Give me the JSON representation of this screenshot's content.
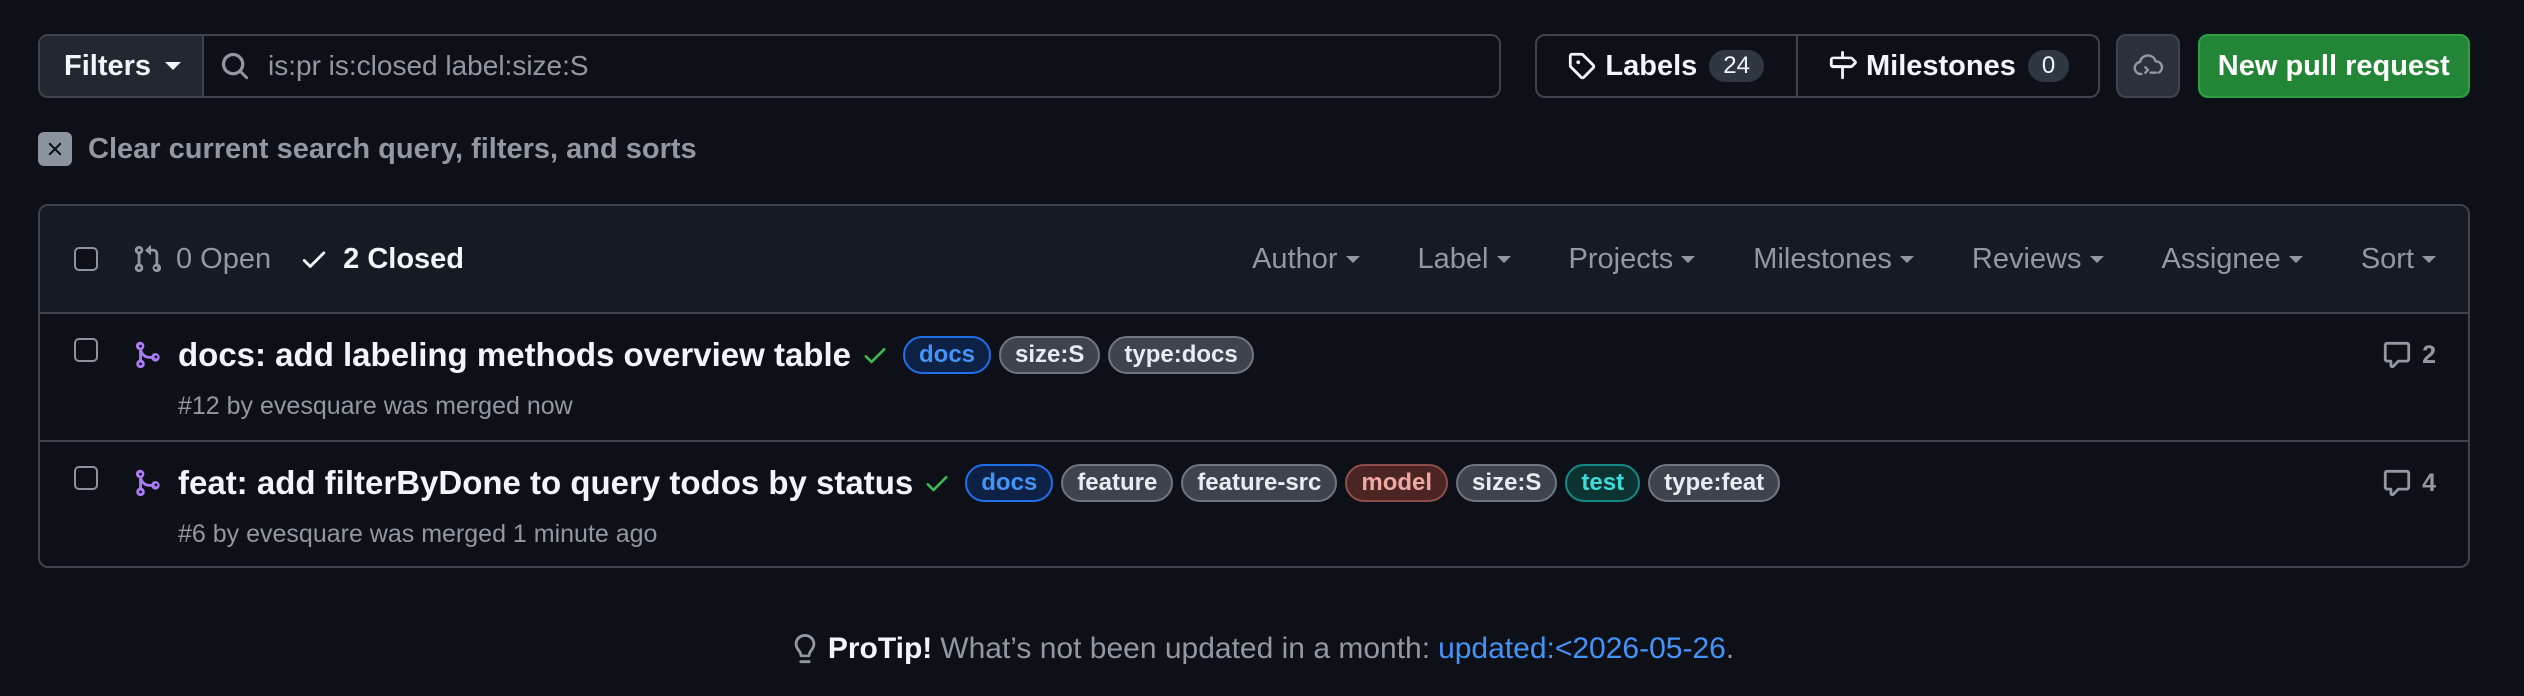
{
  "toolbar": {
    "filters_label": "Filters",
    "search_value": "is:pr is:closed label:size:S",
    "labels_label": "Labels",
    "labels_count": "24",
    "milestones_label": "Milestones",
    "milestones_count": "0",
    "new_pr_label": "New pull request"
  },
  "clear": {
    "label": "Clear current search query, filters, and sorts"
  },
  "list_header": {
    "open_label": "0 Open",
    "closed_label": "2 Closed",
    "filters": [
      "Author",
      "Label",
      "Projects",
      "Milestones",
      "Reviews",
      "Assignee",
      "Sort"
    ]
  },
  "pull_requests": [
    {
      "title": "docs: add labeling methods overview table",
      "meta": "#12 by evesquare was merged now",
      "comments": "2",
      "labels": [
        "docs",
        "size:S",
        "type:docs"
      ]
    },
    {
      "title": "feat: add filterByDone to query todos by status",
      "meta": "#6 by evesquare was merged 1 minute ago",
      "comments": "4",
      "labels": [
        "docs",
        "feature",
        "feature-src",
        "model",
        "size:S",
        "test",
        "type:feat"
      ]
    }
  ],
  "protip": {
    "label": "ProTip!",
    "text": "What’s not been updated in a month:",
    "link": "updated:<2026-05-26",
    "suffix": "."
  },
  "colors": {
    "background": "#0d1117",
    "primary_button": "#238636",
    "merged_purple": "#ab7df8",
    "check_green": "#3fb950",
    "link_blue": "#4493f8"
  }
}
